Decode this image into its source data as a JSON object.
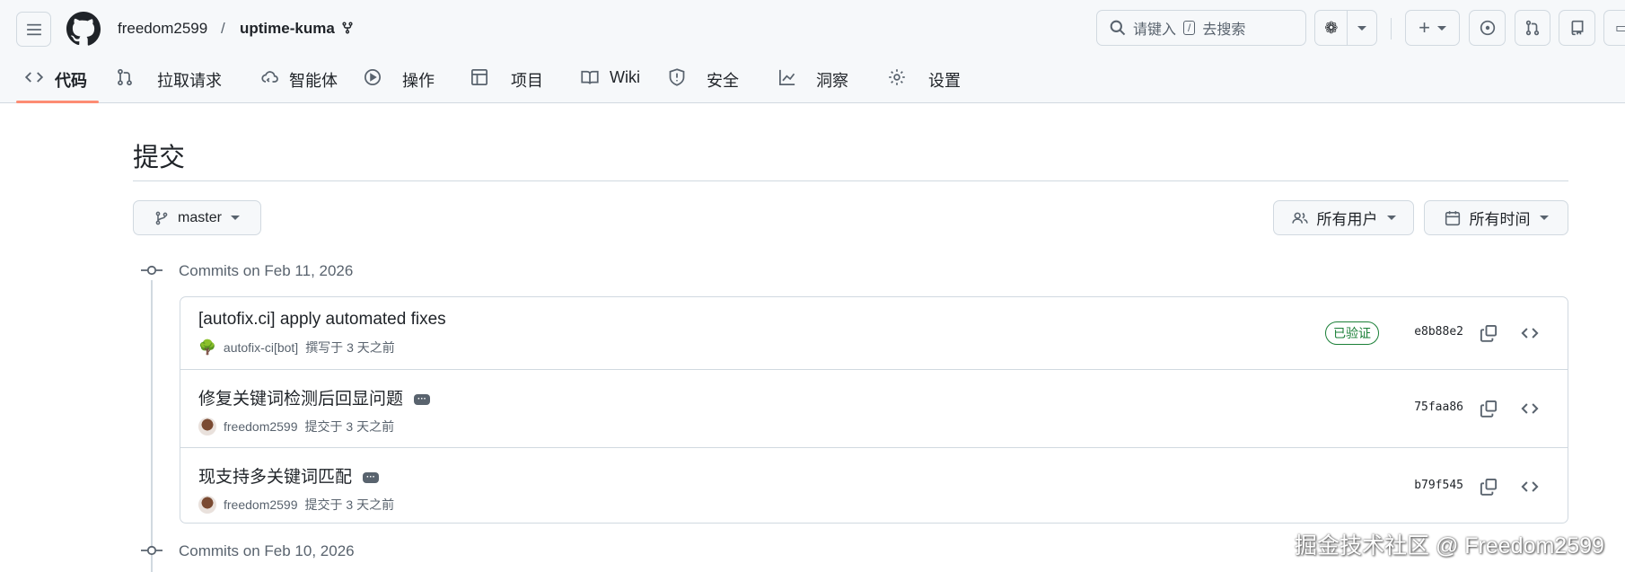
{
  "header": {
    "owner": "freedom2599",
    "separator": "/",
    "repo": "uptime-kuma",
    "search_placeholder": "请键入",
    "search_key": "/",
    "search_suffix": "去搜索"
  },
  "nav": [
    {
      "label": "代码",
      "icon": "code-icon",
      "active": true
    },
    {
      "label": "拉取请求",
      "icon": "pull-request-icon"
    },
    {
      "label": "智能体",
      "icon": "agent-cloud-icon"
    },
    {
      "label": "操作",
      "icon": "play-icon"
    },
    {
      "label": "项目",
      "icon": "table-icon"
    },
    {
      "label": "Wiki",
      "icon": "book-icon"
    },
    {
      "label": "安全",
      "icon": "shield-icon"
    },
    {
      "label": "洞察",
      "icon": "graph-icon"
    },
    {
      "label": "设置",
      "icon": "gear-icon"
    }
  ],
  "page": {
    "title": "提交",
    "branch": "master",
    "users_filter": "所有用户",
    "time_filter": "所有时间"
  },
  "groups": [
    {
      "header": "Commits on Feb 11, 2026",
      "commits": [
        {
          "title": "[autofix.ci] apply automated fixes",
          "author": "autofix-ci[bot]",
          "action": "撰写于 3 天之前",
          "verified": "已验证",
          "sha": "e8b88e2",
          "has_more": false
        },
        {
          "title": "修复关键词检测后回显问题",
          "author": "freedom2599",
          "action": "提交于 3 天之前",
          "sha": "75faa86",
          "has_more": true
        },
        {
          "title": "现支持多关键词匹配",
          "author": "freedom2599",
          "action": "提交于 3 天之前",
          "sha": "b79f545",
          "has_more": true
        }
      ]
    },
    {
      "header": "Commits on Feb 10, 2026"
    }
  ],
  "more_label": "···",
  "watermark": "掘金技术社区 @ Freedom2599",
  "colors": {
    "accent": "#fd8c73",
    "verified": "#1a7f37"
  }
}
